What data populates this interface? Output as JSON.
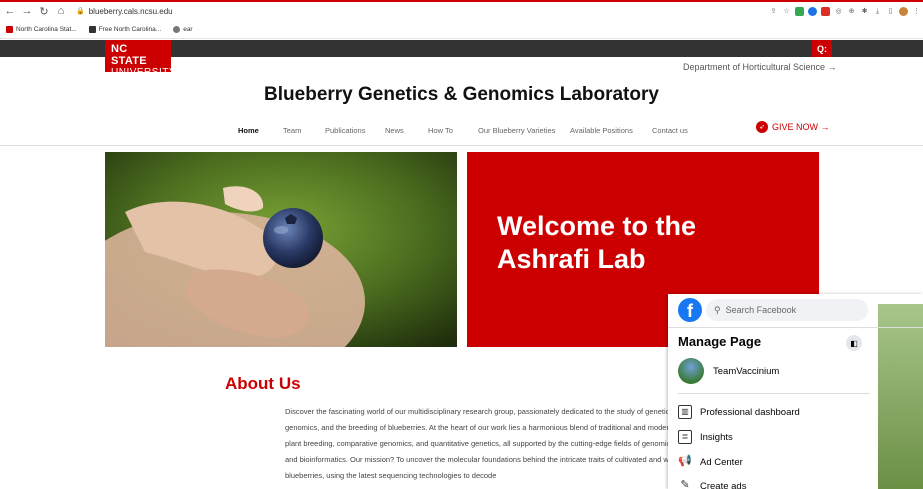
{
  "browser": {
    "url": "blueberry.cals.ncsu.edu",
    "bookmarks": [
      "North Carolina Stat...",
      "Free North Carolina...",
      "ear"
    ]
  },
  "site": {
    "logo_line1": "NC STATE",
    "logo_line2": "UNIVERSITY",
    "search_label": "Q:",
    "dept_link": "Department of Horticultural Science →",
    "title": "Blueberry Genetics & Genomics Laboratory",
    "nav": [
      "Home",
      "Team",
      "Publications",
      "News",
      "How To",
      "Our Blueberry Varieties",
      "Available Positions",
      "Contact us"
    ],
    "give_now": "GIVE NOW →",
    "hero_heading": "Welcome to the Ashrafi Lab",
    "about_heading": "About Us",
    "about_text": "Discover the fascinating world of our multidisciplinary research group, passionately dedicated to the study of genetics, genomics, and the breeding of blueberries. At the heart of our work lies a harmonious blend of traditional and modern plant breeding, comparative genomics, and quantitative genetics, all supported by the cutting-edge fields of genomics and bioinformatics. Our mission? To uncover the molecular foundations behind the intricate traits of cultivated and wild blueberries, using the latest sequencing technologies to decode"
  },
  "facebook": {
    "search_placeholder": "Search Facebook",
    "heading": "Manage Page",
    "page_name": "TeamVaccinium",
    "items": [
      "Professional dashboard",
      "Insights",
      "Ad Center",
      "Create ads"
    ]
  }
}
